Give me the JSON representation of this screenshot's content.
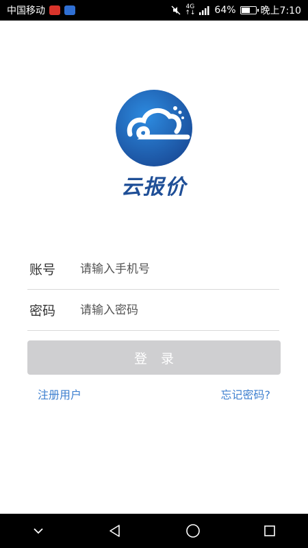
{
  "status_bar": {
    "carrier": "中国移动",
    "network_top": "4G",
    "network_bottom": "↑↓",
    "battery_percent": "64%",
    "battery_level": 0.64,
    "time": "晚上7:10"
  },
  "logo": {
    "brand_name": "云报价",
    "brand_color": "#1f4f97"
  },
  "form": {
    "account_label": "账号",
    "account_placeholder": "请输入手机号",
    "account_value": "",
    "password_label": "密码",
    "password_placeholder": "请输入密码",
    "password_value": ""
  },
  "login_button": {
    "label": "登录"
  },
  "links": {
    "register": "注册用户",
    "forgot_password": "忘记密码?"
  },
  "nav_bar": {
    "icons": [
      "chevron-down-icon",
      "back-triangle-icon",
      "home-circle-icon",
      "recents-square-icon"
    ]
  }
}
